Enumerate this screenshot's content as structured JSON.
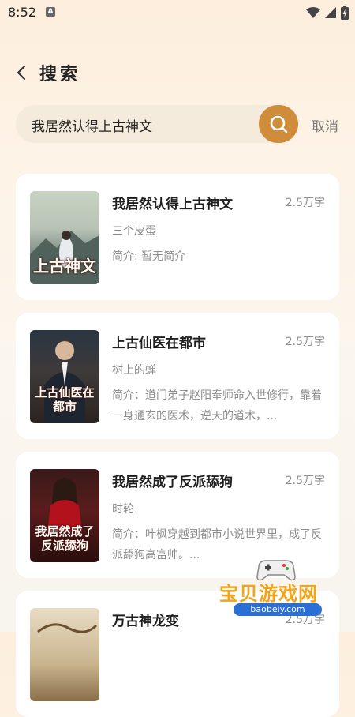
{
  "status_bar": {
    "time": "8:52",
    "notif_letter": "A"
  },
  "header": {
    "title": "搜索"
  },
  "search": {
    "value": "我居然认得上古神文",
    "cancel_label": "取消"
  },
  "colors": {
    "accent": "#cf8c3a",
    "card_bg": "#ffffff",
    "muted_text": "#8c8c8c"
  },
  "results": [
    {
      "title": "我居然认得上古神文",
      "words": "2.5万字",
      "author": "三个皮蛋",
      "intro": "简介: 暂无简介",
      "cover_text": "上古神文"
    },
    {
      "title": "上古仙医在都市",
      "words": "2.5万字",
      "author": "树上的蝉",
      "intro": "简介：道门弟子赵阳奉师命入世修行，靠着一身通玄的医术，逆天的道术，...",
      "cover_text": "上古仙医在都市"
    },
    {
      "title": "我居然成了反派舔狗",
      "words": "2.5万字",
      "author": "时轮",
      "intro": "简介：叶枫穿越到都市小说世界里，成了反派舔狗高富帅。...",
      "cover_text": "我居然成了反派舔狗"
    },
    {
      "title": "万古神龙变",
      "words": "2.5万字",
      "author": "",
      "intro": "",
      "cover_text": ""
    }
  ],
  "watermark": {
    "text": "宝贝游戏网",
    "url": "baobeiy.com"
  }
}
